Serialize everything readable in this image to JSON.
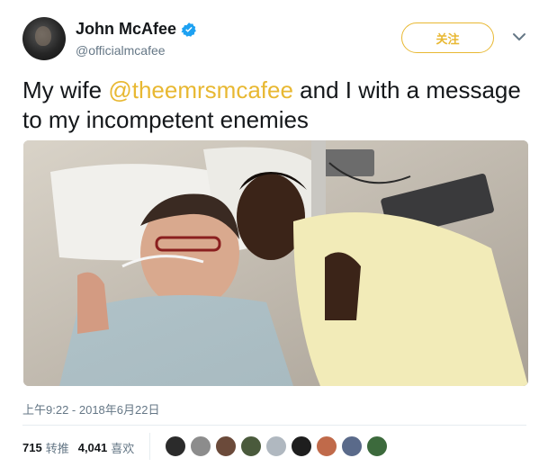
{
  "user": {
    "name": "John McAfee",
    "handle": "@officialmcafee",
    "verified_icon": "verified-badge-icon"
  },
  "follow_button": {
    "label": "关注"
  },
  "menu_icon": "chevron-down-icon",
  "tweet": {
    "text_before": "My wife ",
    "mention": "@theemrsmcafee",
    "text_after": " and I with a message to my incompetent enemies"
  },
  "timestamp": "上午9:22 - 2018年6月22日",
  "stats": {
    "retweets_count": "715",
    "retweets_label": "转推",
    "likes_count": "4,041",
    "likes_label": "喜欢"
  },
  "liker_avatars": [
    {
      "name": "liker-avatar-1",
      "color": "#2b2b2b"
    },
    {
      "name": "liker-avatar-2",
      "color": "#8c8c8c"
    },
    {
      "name": "liker-avatar-3",
      "color": "#6b4a3a"
    },
    {
      "name": "liker-avatar-4",
      "color": "#4a5a3c"
    },
    {
      "name": "liker-avatar-5",
      "color": "#b0b8c0"
    },
    {
      "name": "liker-avatar-6",
      "color": "#1e1e1e"
    },
    {
      "name": "liker-avatar-7",
      "color": "#c06a4a"
    },
    {
      "name": "liker-avatar-8",
      "color": "#5a6a8a"
    },
    {
      "name": "liker-avatar-9",
      "color": "#3c6a3c"
    }
  ],
  "colors": {
    "accent": "#e8b832",
    "text": "#14171a",
    "secondary": "#657786"
  }
}
